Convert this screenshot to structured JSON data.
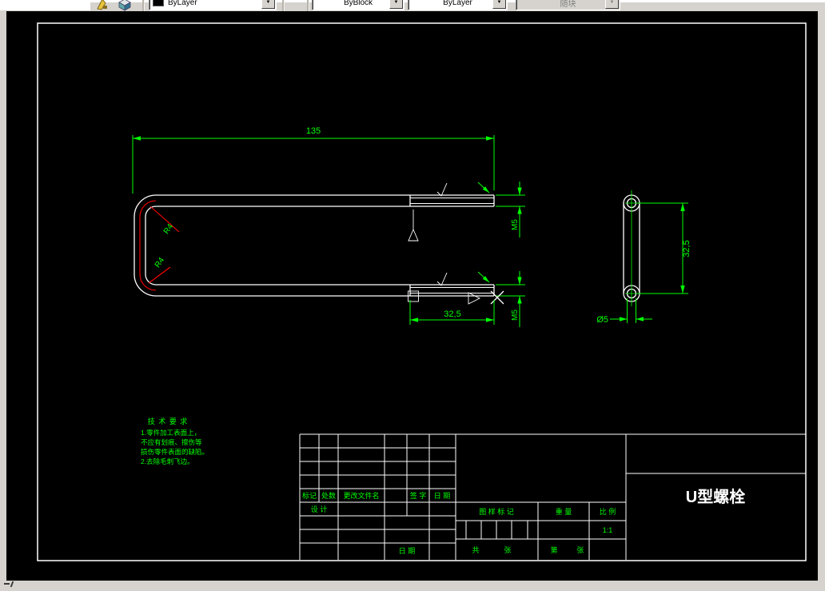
{
  "toolbar": {
    "combos": [
      {
        "label": "ByLayer"
      },
      {
        "label": "ByBlock"
      },
      {
        "label": "ByLayer"
      },
      {
        "label": "随块"
      }
    ]
  },
  "drawing": {
    "colors": {
      "object": "#ffffff",
      "dimension": "#00ff00",
      "accent": "#ff0000"
    },
    "dimensions": {
      "overall_length": "135",
      "thread_length": "32,5",
      "side_span": "32,5",
      "thread_size_top": "M5",
      "thread_size_bottom": "M5",
      "hole_diameter": "Ø5",
      "fillet_radius_upper": "R4",
      "fillet_radius_lower": "R4"
    },
    "notes": {
      "title": "技 术 要 求",
      "lines": [
        "1.零件加工表面上，",
        "不应有划痕、擦伤等",
        "损伤零件表面的缺陷。",
        "2.去除毛刺飞边。"
      ]
    }
  },
  "title_block": {
    "part_name": "U型螺栓",
    "revision_headers": [
      "标记",
      "处数",
      "更改文件名",
      "签  字",
      "日 期"
    ],
    "design_label": "设 计",
    "date_label": "日 期",
    "stamp_label": "图 样 标 记",
    "weight_label": "重 量",
    "scale_label": "比 例",
    "scale_value": "1:1",
    "sheets_total_label": "共",
    "sheets_total_unit": "张",
    "sheet_no_label": "第",
    "sheet_no_unit": "张"
  }
}
